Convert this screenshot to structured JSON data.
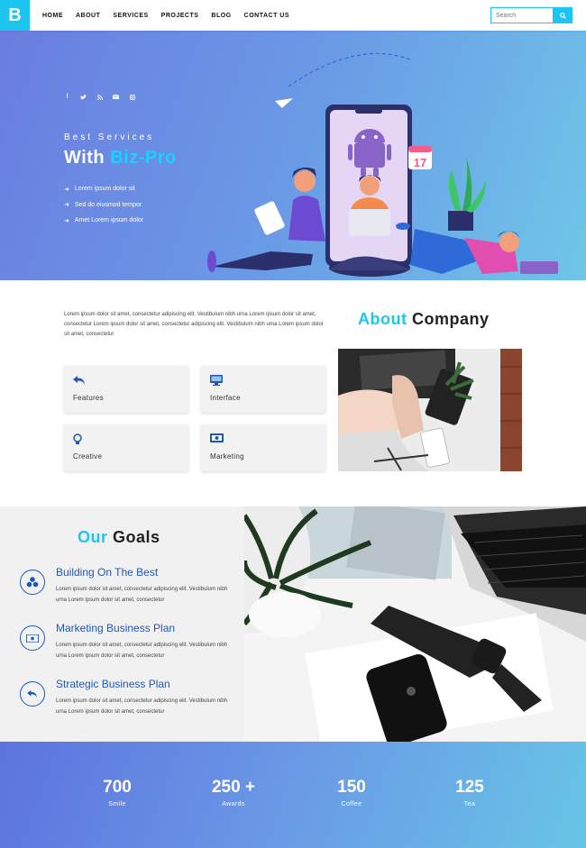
{
  "nav": {
    "logo": "B",
    "items": [
      "HOME",
      "ABOUT",
      "SERVICES",
      "PROJECTS",
      "BLOG",
      "CONTACT US"
    ],
    "search_placeholder": "Search"
  },
  "hero": {
    "social_icons": [
      "facebook-icon",
      "twitter-icon",
      "rss-icon",
      "mail-icon",
      "instagram-icon"
    ],
    "subtitle": "Best Services",
    "title_prefix": "With ",
    "title_highlight": "Biz-Pro",
    "list": [
      "Lorem ipsum dolor sit",
      "Sed do eiusmod tempor",
      "Amet Lorem ipsum dolor"
    ],
    "calendar_day": "17"
  },
  "about": {
    "heading_highlight": "About",
    "heading_rest": " Company",
    "text": "Lorem ipsum dolor sit amet, consectetur adipiscing elit. Vestibulum nibh urna Lorem ipsum dolor sit amet, consectetur Lorem ipsum dolor sit amet, consectetur adipiscing elit. Vestibulum nibh urna Lorem ipsum dolor sit amet, consectetur",
    "cards": [
      {
        "label": "Features",
        "icon": "reply-icon"
      },
      {
        "label": "Interface",
        "icon": "monitor-icon"
      },
      {
        "label": "Creative",
        "icon": "lightbulb-icon"
      },
      {
        "label": "Marketing",
        "icon": "money-icon"
      }
    ]
  },
  "goals": {
    "heading_highlight": "Our",
    "heading_rest": " Goals",
    "items": [
      {
        "title": "Building On The Best",
        "desc": "Lorem ipsum dolor sit amet, consectetur adipiscing elit. Vestibulum nibh urna Lorem ipsum dolor sit amet, consectetur",
        "icon": "cubes-icon"
      },
      {
        "title": "Marketing Business Plan",
        "desc": "Lorem ipsum dolor sit amet, consectetur adipiscing elit. Vestibulum nibh urna Lorem ipsum dolor sit amet, consectetur",
        "icon": "money-icon"
      },
      {
        "title": "Strategic Business Plan",
        "desc": "Lorem ipsum dolor sit amet, consectetur adipiscing elit. Vestibulum nibh urna Lorem ipsum dolor sit amet, consectetur",
        "icon": "reply-icon"
      }
    ]
  },
  "stats": [
    {
      "value": "700",
      "label": "Smile"
    },
    {
      "value": "250 +",
      "label": "Awards"
    },
    {
      "value": "150",
      "label": "Coffee"
    },
    {
      "value": "125",
      "label": "Tea"
    }
  ],
  "colors": {
    "accent": "#1cc6f0",
    "goal_blue": "#1f57b8",
    "hero_start": "#6a7de0",
    "hero_end": "#6fc6e8"
  }
}
